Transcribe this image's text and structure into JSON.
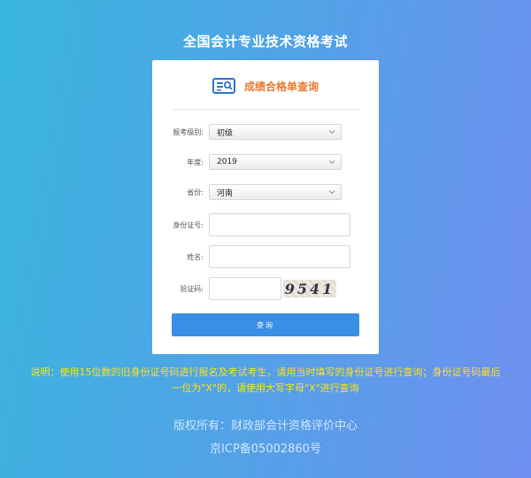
{
  "page_title": "全国会计专业技术资格考试",
  "card": {
    "heading": "成绩合格单查询",
    "logo_icon": "document-search-icon"
  },
  "form": {
    "level": {
      "label": "报考级别:",
      "value": "初级"
    },
    "year": {
      "label": "年度:",
      "value": "2019"
    },
    "province": {
      "label": "省份:",
      "value": "河南"
    },
    "id_number": {
      "label": "身份证号:",
      "value": ""
    },
    "name": {
      "label": "姓名:",
      "value": ""
    },
    "captcha": {
      "label": "验证码:",
      "value": "",
      "code": "9541"
    },
    "submit_label": "查询"
  },
  "note": {
    "line1": "说明：使用15位数的旧身份证号码进行报名及考试考生，请用当时填写的身份证号进行查询；身份证号码最后",
    "line2": "一位为\"X\"的，请使用大写字母\"X\"进行查询"
  },
  "footer": {
    "copyright": "版权所有：财政部会计资格评价中心",
    "icp": "京ICP备05002860号"
  },
  "colors": {
    "heading": "#e8792f",
    "button": "#3b8ee5",
    "note": "#ffe21a"
  }
}
